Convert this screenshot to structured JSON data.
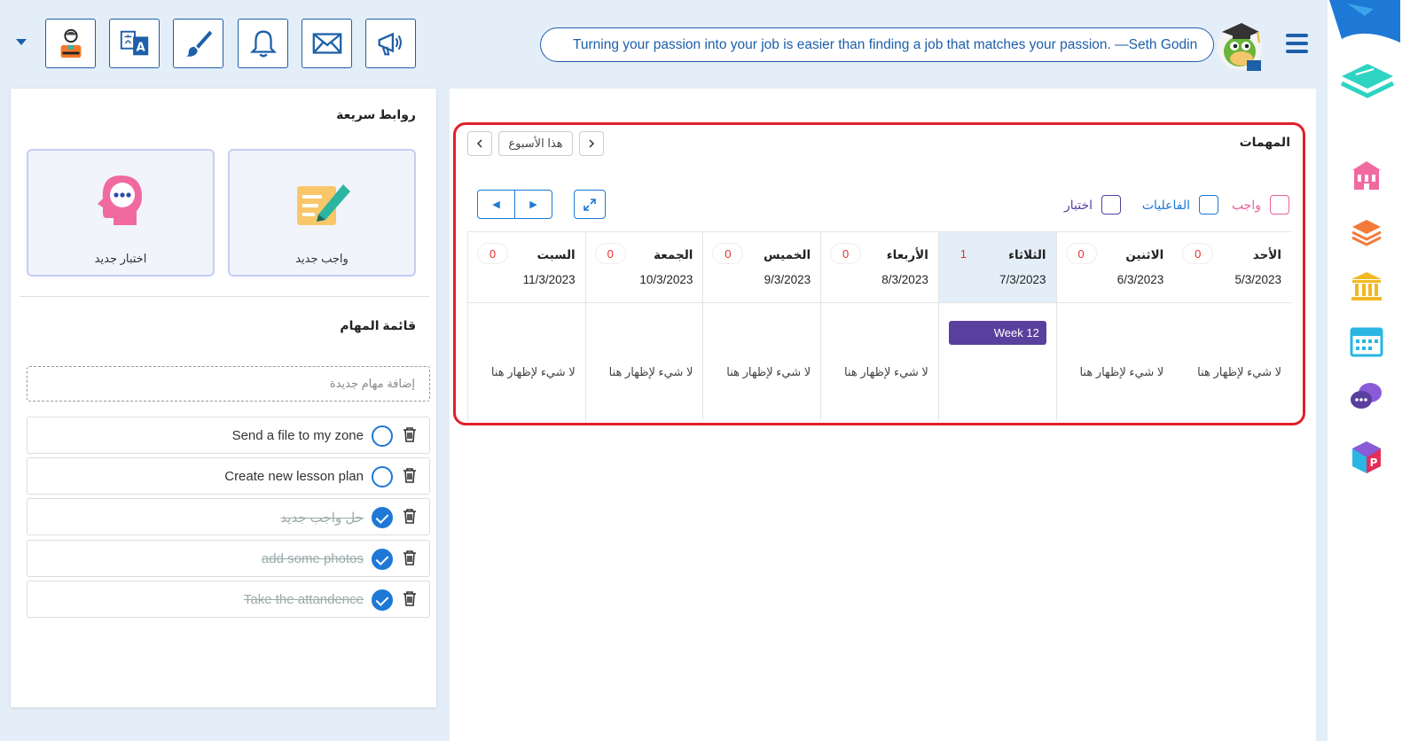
{
  "header": {
    "quote": "Turning your passion into your job is easier than finding a job that matches your passion. —Seth Godin",
    "toolbar_icons": [
      "profile-icon",
      "translate-icon",
      "brush-icon",
      "bell-icon",
      "mail-icon",
      "megaphone-icon"
    ]
  },
  "sidebar": {
    "icons": [
      "school-icon",
      "books-icon",
      "institution-icon",
      "calendar-icon",
      "chat-icon",
      "cube-icon"
    ]
  },
  "quick_links": {
    "title": "روابط سريعة",
    "new_exam": "اختبار جديد",
    "new_homework": "واجب جديد"
  },
  "todo": {
    "title": "قائمة المهام",
    "add_placeholder": "إضافة مهام جديدة",
    "items": [
      {
        "text": "Send a file to my zone",
        "done": false
      },
      {
        "text": "Create new lesson plan",
        "done": false
      },
      {
        "text": "حل واجب جديد",
        "done": true
      },
      {
        "text": "add some photos",
        "done": true
      },
      {
        "text": "Take the attandence",
        "done": true
      }
    ]
  },
  "calendar": {
    "title": "المهمات",
    "this_week": "هذا الأسبوع",
    "legend": {
      "homework": "واجب",
      "activities": "الفاعليات",
      "exam": "اختبار"
    },
    "colors": {
      "homework": "#ef5b9c",
      "activities": "#1d78d6",
      "exam": "#5a3f9e",
      "count": "#e52d2d"
    },
    "days": [
      {
        "name": "الأحد",
        "date": "5/3/2023",
        "count": "0",
        "empty": "لا شيء لإظهار هنا"
      },
      {
        "name": "الاثنين",
        "date": "6/3/2023",
        "count": "0",
        "empty": "لا شيء لإظهار هنا"
      },
      {
        "name": "الثلاثاء",
        "date": "7/3/2023",
        "count": "1",
        "event": "Week 12"
      },
      {
        "name": "الأربعاء",
        "date": "8/3/2023",
        "count": "0",
        "empty": "لا شيء لإظهار هنا"
      },
      {
        "name": "الخميس",
        "date": "9/3/2023",
        "count": "0",
        "empty": "لا شيء لإظهار هنا"
      },
      {
        "name": "الجمعة",
        "date": "10/3/2023",
        "count": "0",
        "empty": "لا شيء لإظهار هنا"
      },
      {
        "name": "السبت",
        "date": "11/3/2023",
        "count": "0",
        "empty": "لا شيء لإظهار هنا"
      }
    ]
  }
}
